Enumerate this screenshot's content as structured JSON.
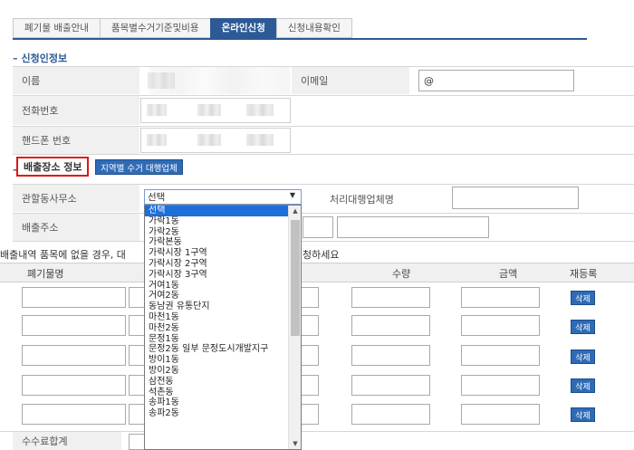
{
  "tabs": [
    {
      "label": "폐기물 배출안내",
      "active": false
    },
    {
      "label": "품목별수거기준및비용",
      "active": false
    },
    {
      "label": "온라인신청",
      "active": true
    },
    {
      "label": "신청내용확인",
      "active": false
    }
  ],
  "applicant": {
    "section_title": "신청인정보",
    "name_label": "이름",
    "email_label": "이메일",
    "email_at": "@",
    "phone_label": "전화번호",
    "mobile_label": "핸드폰 번호"
  },
  "location": {
    "section_title": "배출장소 정보",
    "agency_button": "지역별 수거 대행업체",
    "office_label": "관할동사무소",
    "select_value": "선택",
    "contractor_label": "처리대행업체명",
    "address_label": "배출주소"
  },
  "dropdown_options": [
    "선택",
    "가락1동",
    "가락2동",
    "가락본동",
    "가락시장 1구역",
    "가락시장 2구역",
    "가락시장 3구역",
    "거여1동",
    "거여2동",
    "동남권 유통단지",
    "마천1동",
    "마천2동",
    "문정1동",
    "문정2동 일부 문정도시개발지구",
    "방이1동",
    "방이2동",
    "삼전동",
    "석촌동",
    "송파1동",
    "송파2동"
  ],
  "items": {
    "notice_left": "배출내역 품목에 없을 경우, 대",
    "notice_right": "청하세요",
    "col_waste": "폐기물명",
    "col_qty": "수량",
    "col_amount": "금액",
    "col_reregister": "재등록",
    "delete_label": "삭제",
    "fee_total_label": "수수료합계"
  },
  "colors": {
    "accent": "#2d5a96",
    "button": "#2f6bb5",
    "highlight": "#e01515",
    "selected_option": "#1e6fd9"
  }
}
